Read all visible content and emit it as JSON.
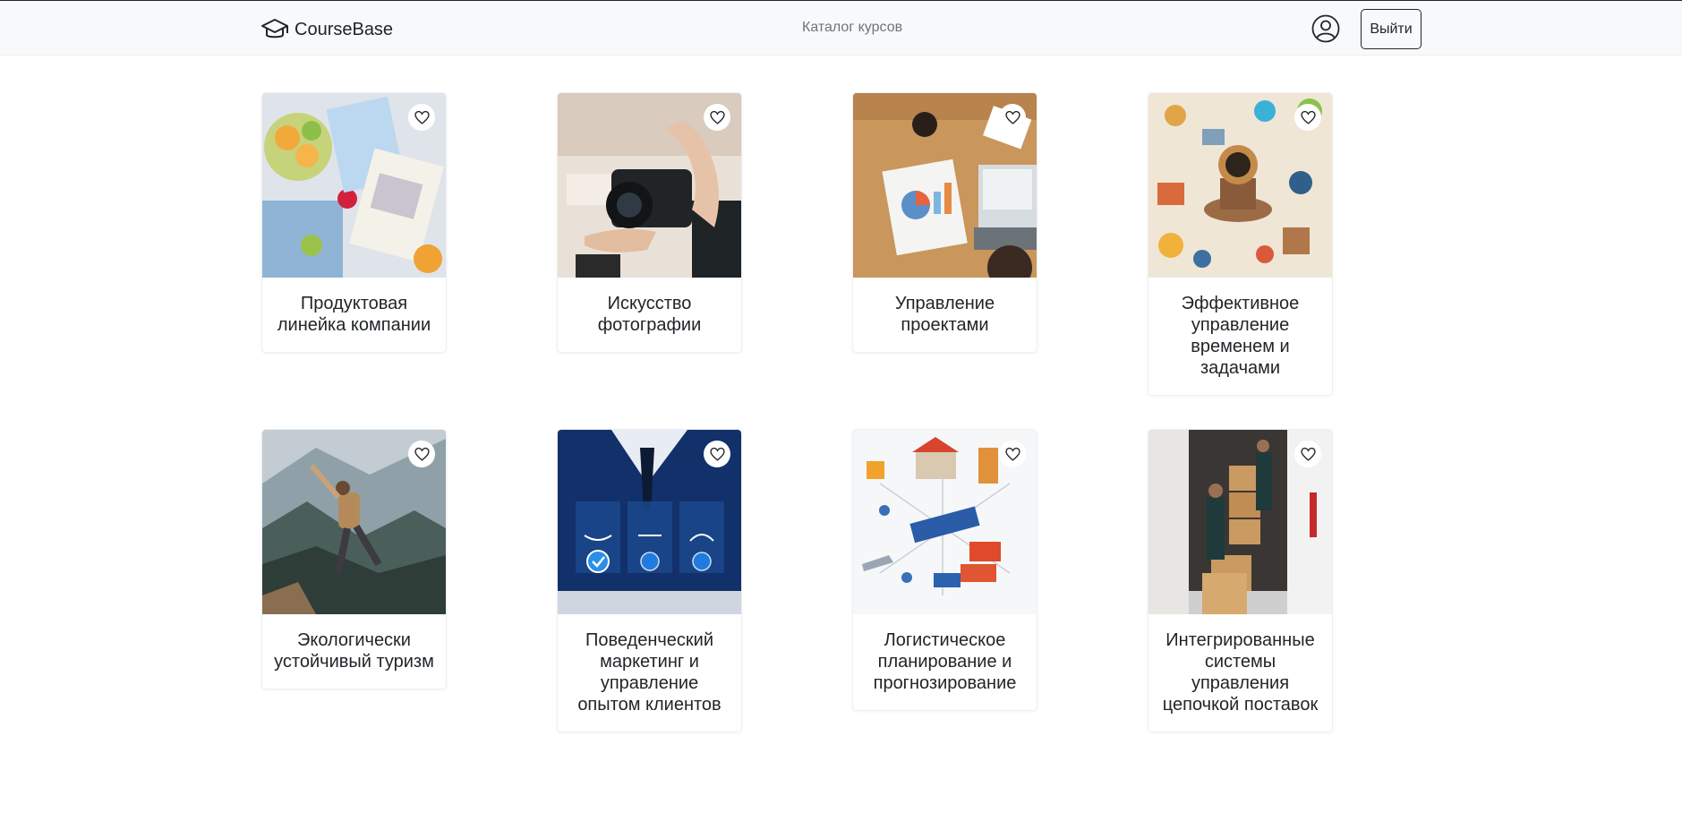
{
  "app": {
    "name": "CourseBase"
  },
  "nav": {
    "catalog_label": "Каталог курсов",
    "logout_label": "Выйти"
  },
  "courses": [
    {
      "title": "Продуктовая линейка компании",
      "image": "fruits-and-product-box"
    },
    {
      "title": "Искусство фотографии",
      "image": "camera-in-hands"
    },
    {
      "title": "Управление проектами",
      "image": "desk-with-charts-and-laptop"
    },
    {
      "title": "Эффективное управление временем и задачами",
      "image": "lightbulb-icons-collage"
    },
    {
      "title": "Экологически устойчивый туризм",
      "image": "hiker-jumping-mountains"
    },
    {
      "title": "Поведенческий маркетинг и управление опытом клиентов",
      "image": "feedback-smileys-tablet"
    },
    {
      "title": "Логистическое планирование и прогнозирование",
      "image": "logistics-infographic"
    },
    {
      "title": "Интегрированные системы управления цепочкой поставок",
      "image": "delivery-van-boxes"
    }
  ],
  "icons": {
    "brand": "graduation-cap-icon",
    "profile": "user-circle-icon",
    "favorite": "heart-outline-icon"
  },
  "colors": {
    "navbar_bg": "#f8f9fa",
    "text": "#212529",
    "muted": "#6c757d"
  }
}
